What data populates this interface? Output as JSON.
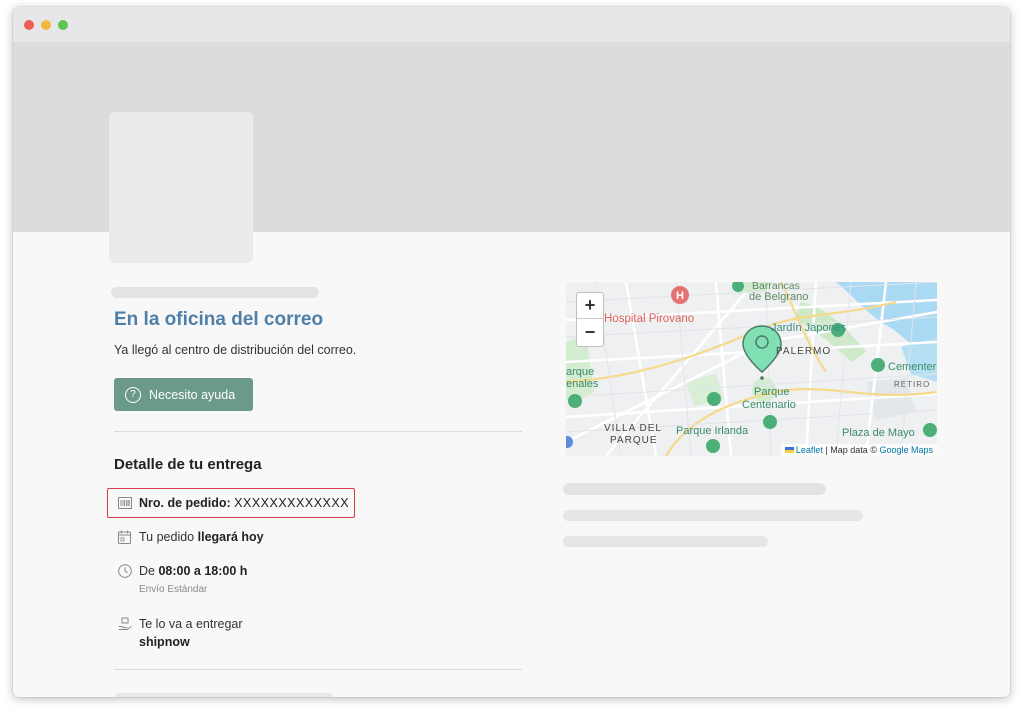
{
  "status": {
    "title": "En la oficina del correo",
    "subtitle": "Ya llegó al centro de distribución del correo.",
    "help_button": "Necesito ayuda"
  },
  "detail": {
    "title": "Detalle de tu entrega",
    "order_label": "Nro. de pedido:",
    "order_value": "XXXXXXXXXXXXX",
    "arrival_prefix": "Tu pedido",
    "arrival_value": "llegará hoy",
    "time_prefix": "De",
    "time_value": "08:00 a 18:00 h",
    "shipping_type": "Envío Estándar",
    "carrier_label": "Te lo va a entregar",
    "carrier_name": "shipnow"
  },
  "map": {
    "zoom_in": "+",
    "zoom_out": "−",
    "attribution_leaflet": "Leaflet",
    "attribution_text": "| Map data ©",
    "attribution_google": "Google Maps",
    "labels": {
      "barrancas": "Barrancas",
      "belgrano": "de Belgrano",
      "hospital": "Hospital Pirovano",
      "jardin": "Jardín Japonés",
      "palermo": "PALERMO",
      "cementerio": "Cementerio",
      "retiro": "RETIRO",
      "parque_centenario_1": "Parque",
      "parque_centenario_2": "Centenario",
      "villa_1": "VILLA DEL",
      "villa_2": "PARQUE",
      "irlanda": "Parque Irlanda",
      "plaza": "Plaza de Mayo",
      "left_1": "arque",
      "left_2": "enales"
    }
  },
  "colors": {
    "accent_title": "#4f7fa6",
    "button_bg": "#6b9a89",
    "highlight_border": "#d9394a",
    "marker": "#80e0b4"
  },
  "icons": {
    "help": "question-circle-icon",
    "order": "barcode-icon",
    "calendar": "calendar-icon",
    "clock": "clock-icon",
    "carrier": "hand-package-icon",
    "marker": "map-pin-icon"
  }
}
